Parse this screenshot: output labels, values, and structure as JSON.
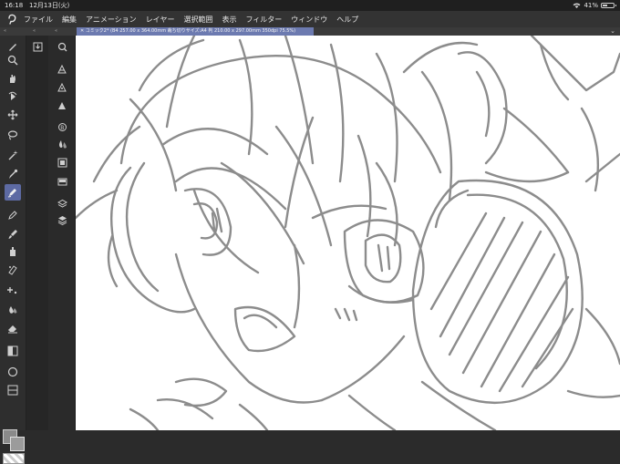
{
  "status": {
    "time": "16:18",
    "date": "12月13日(火)",
    "battery": "41%",
    "battery_level": 0.41
  },
  "menu": {
    "items": [
      "ファイル",
      "編集",
      "アニメーション",
      "レイヤー",
      "選択範囲",
      "表示",
      "フィルター",
      "ウィンドウ",
      "ヘルプ"
    ]
  },
  "tab": {
    "label": "✕ コミック2* (B4 257.00 x 364.00mm 裁ち切りサイズ:A4 判 210.00 x 297.00mm 350dpi 75.5%)"
  },
  "mini_labels": {
    "a": "«",
    "b": "«",
    "c": "«"
  },
  "colors": {
    "accent": "#5d6aa3",
    "tab_bg": "#6c7ab0",
    "canvas_bg": "#ffffff",
    "main_color": "#8a8a8a",
    "sub_color": "#9b9b9b"
  },
  "tools": [
    "zoom-icon",
    "move-hand-icon",
    "rotate-icon",
    "move-icon",
    "lasso-icon",
    "magic-wand-icon",
    "eyedropper-icon",
    "pen-icon",
    "pencil-icon",
    "brush-icon",
    "airbrush-icon",
    "decoration-icon",
    "blend-icon",
    "eraser-icon",
    "gradient-icon",
    "figure-icon"
  ]
}
